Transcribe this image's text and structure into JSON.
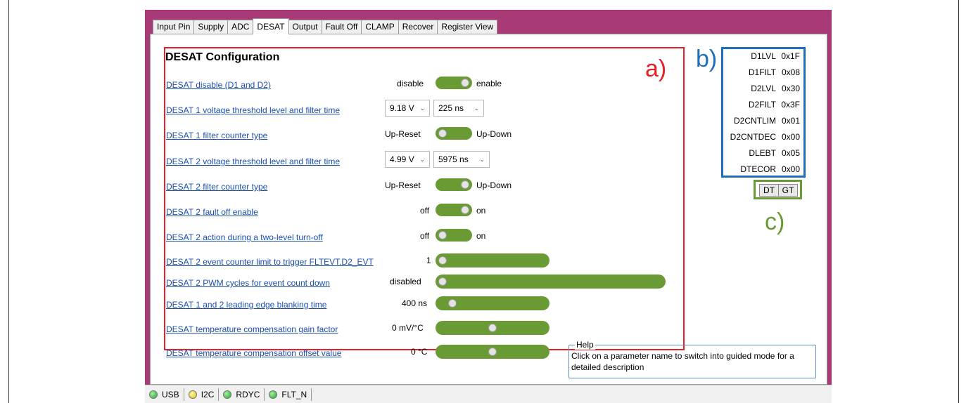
{
  "tabs": [
    "Input Pin",
    "Supply",
    "ADC",
    "DESAT",
    "Output",
    "Fault Off",
    "CLAMP",
    "Recover",
    "Register View"
  ],
  "active_tab": "DESAT",
  "config": {
    "title": "DESAT Configuration",
    "rows": {
      "desat_disable": {
        "label": "DESAT disable (D1 and D2)",
        "left": "disable",
        "right": "enable",
        "state": "enable"
      },
      "desat1_threshold": {
        "label": "DESAT 1 voltage threshold level and filter time",
        "voltage": "9.18 V",
        "time": "225 ns"
      },
      "desat1_counter": {
        "label": "DESAT 1 filter counter type",
        "left": "Up-Reset",
        "right": "Up-Down",
        "state": "Up-Reset"
      },
      "desat2_threshold": {
        "label": "DESAT 2 voltage threshold level and filter time",
        "voltage": "4.99 V",
        "time": "5975 ns"
      },
      "desat2_counter": {
        "label": "DESAT 2 filter counter type",
        "left": "Up-Reset",
        "right": "Up-Down",
        "state": "Up-Down"
      },
      "desat2_fault_off": {
        "label": "DESAT 2 fault off enable",
        "left": "off",
        "right": "on",
        "state": "on"
      },
      "desat2_action": {
        "label": "DESAT 2 action during a two-level turn-off",
        "left": "off",
        "right": "on",
        "state": "off"
      },
      "desat2_event_limit": {
        "label": "DESAT 2 event counter limit to trigger FLTEVT.D2_EVT",
        "value": "1",
        "level": 0.0
      },
      "desat2_pwm_cycles": {
        "label": "DESAT 2 PWM cycles for event count down",
        "value": "disabled",
        "level": 0.0
      },
      "leading_edge": {
        "label": "DESAT 1 and 2 leading edge blanking time",
        "value": "400 ns",
        "level": 0.1
      },
      "temp_gain": {
        "label": "DESAT temperature compensation gain factor",
        "value": "0 mV/°C",
        "level": 0.5
      },
      "temp_offset": {
        "label": "DESAT temperature compensation offset value",
        "value": "0 °C",
        "level": 0.5
      }
    }
  },
  "annotations": {
    "a": "a)",
    "b": "b)",
    "c": "c)"
  },
  "registers": [
    {
      "name": "D1LVL",
      "value": "0x1F"
    },
    {
      "name": "D1FILT",
      "value": "0x08"
    },
    {
      "name": "D2LVL",
      "value": "0x30"
    },
    {
      "name": "D2FILT",
      "value": "0x3F"
    },
    {
      "name": "D2CNTLIM",
      "value": "0x01"
    },
    {
      "name": "D2CNTDEC",
      "value": "0x00"
    },
    {
      "name": "DLEBT",
      "value": "0x05"
    },
    {
      "name": "DTECOR",
      "value": "0x00"
    }
  ],
  "buttons": {
    "dt": "DT",
    "gt": "GT"
  },
  "help": {
    "legend": "Help",
    "text": "Click on a parameter name to switch into guided mode for a detailed description"
  },
  "status": [
    {
      "label": "USB",
      "color": "#1fa82a"
    },
    {
      "label": "I2C",
      "color": "#d8c21a"
    },
    {
      "label": "RDYC",
      "color": "#1fa82a"
    },
    {
      "label": "FLT_N",
      "color": "#1fa82a"
    }
  ],
  "colors": {
    "frame": "#a83a78",
    "accent_green": "#6a9a34",
    "link": "#1a4fb0",
    "annotation_red": "#e8202a",
    "annotation_blue": "#1f6fc0"
  }
}
